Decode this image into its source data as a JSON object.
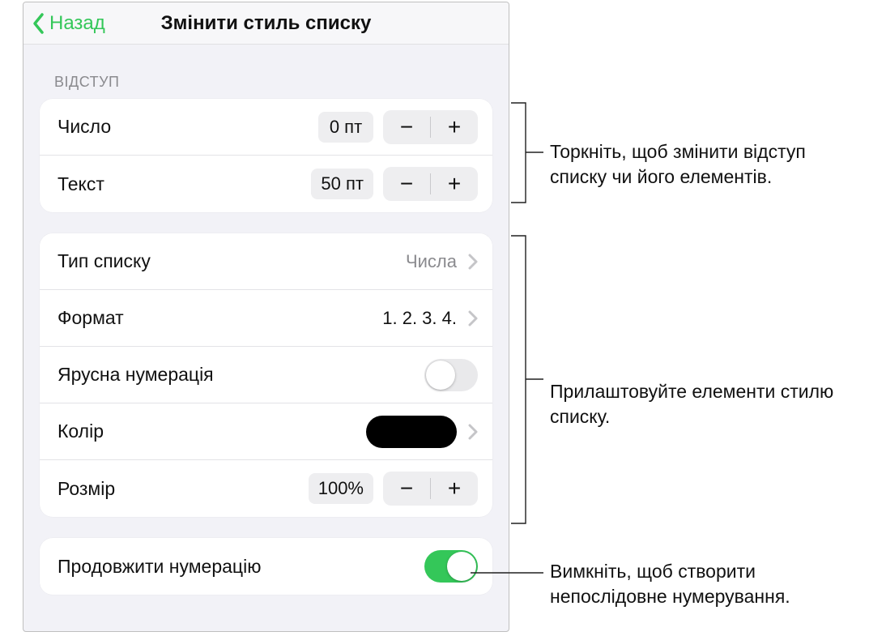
{
  "header": {
    "back": "Назад",
    "title": "Змінити стиль списку"
  },
  "indent": {
    "section": "ВІДСТУП",
    "number_label": "Число",
    "number_value": "0 пт",
    "text_label": "Текст",
    "text_value": "50 пт"
  },
  "style": {
    "list_type_label": "Тип списку",
    "list_type_value": "Числа",
    "format_label": "Формат",
    "format_value": "1. 2. 3. 4.",
    "tiered_label": "Ярусна нумерація",
    "tiered_on": false,
    "color_label": "Колір",
    "color_value": "#000000",
    "size_label": "Розмір",
    "size_value": "100%"
  },
  "continue": {
    "label": "Продовжити нумерацію",
    "on": true
  },
  "callouts": {
    "a": "Торкніть, щоб змінити відступ списку чи його елементів.",
    "b": "Прилаштовуйте елементи стилю списку.",
    "c": "Вимкніть, щоб створити непослідовне нумерування."
  }
}
